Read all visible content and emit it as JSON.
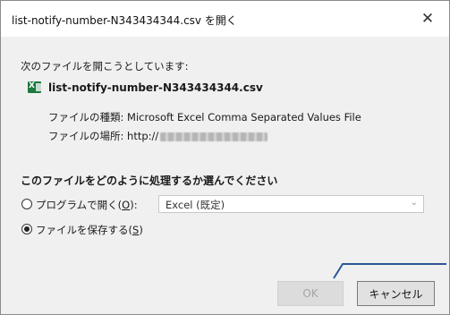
{
  "window": {
    "title": "list-notify-number-N343434344.csv を開く",
    "close_glyph": "✕"
  },
  "info": {
    "intro": "次のファイルを開こうとしています:",
    "filename": "list-notify-number-N343434344.csv",
    "type_label": "ファイルの種類:",
    "type_value": "Microsoft Excel Comma Separated Values File",
    "location_label": "ファイルの場所:",
    "location_value": "http://"
  },
  "choice": {
    "heading": "このファイルをどのように処理するか選んでください",
    "open_with": {
      "label_pre": "プログラムで開く(",
      "accesskey": "O",
      "label_post": "):",
      "selected": false,
      "program_value": "Excel (既定)"
    },
    "save": {
      "label_pre": "ファイルを保存する(",
      "accesskey": "S",
      "label_post": ")",
      "selected": true
    }
  },
  "buttons": {
    "ok_label": "OK",
    "ok_enabled": false,
    "cancel_label": "キャンセル"
  },
  "colors": {
    "annotation_line": "#2b5797",
    "excel_icon": "#1d7a3f"
  }
}
